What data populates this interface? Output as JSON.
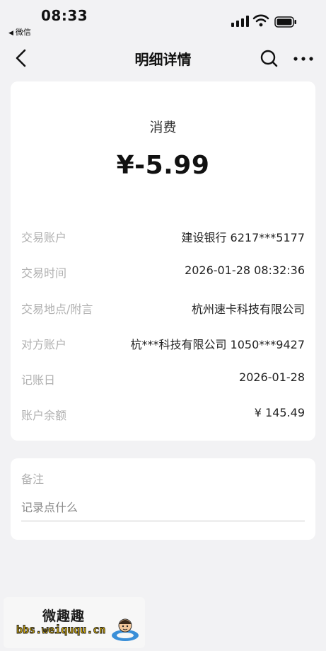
{
  "status_bar": {
    "time": "08:33",
    "back_app_label": "微信",
    "icons": [
      "signal-icon",
      "wifi-icon",
      "battery-icon"
    ]
  },
  "nav": {
    "title": "明细详情",
    "icons": [
      "back-chevron-icon",
      "search-icon",
      "more-icon"
    ]
  },
  "transaction": {
    "type": "消费",
    "amount": "¥-5.99",
    "rows": [
      {
        "label": "交易账户",
        "value": "建设银行 6217***5177"
      },
      {
        "label": "交易时间",
        "value": "2026-01-28 08:32:36"
      },
      {
        "label": "交易地点/附言",
        "value": "杭州速卡科技有限公司"
      },
      {
        "label": "对方账户",
        "value": "杭***科技有限公司 1050***9427"
      },
      {
        "label": "记账日",
        "value": "2026-01-28"
      },
      {
        "label": "账户余额",
        "value": "¥ 145.49"
      }
    ]
  },
  "note": {
    "label": "备注",
    "placeholder": "记录点什么"
  },
  "watermark": {
    "line1": "微趣趣",
    "line2": "bbs.weiququ.cn"
  },
  "colors": {
    "background": "#f2f2f4",
    "card": "#ffffff",
    "label_gray": "#b0b0b0",
    "watermark_yellow": "#f5c400"
  }
}
